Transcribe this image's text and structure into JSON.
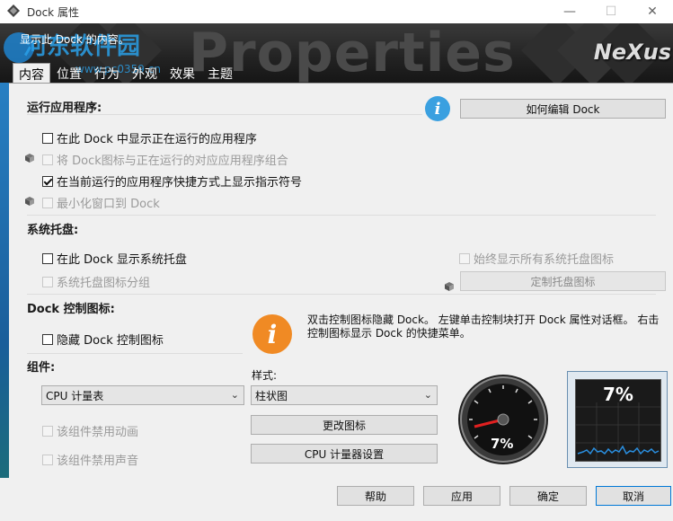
{
  "window": {
    "title": "Dock 属性",
    "controls": {
      "minimize": "—",
      "maximize": "☐",
      "close": "✕"
    }
  },
  "banner": {
    "subtitle": "显示此 Dock 的内容。",
    "title": "Properties",
    "brand": "NeXus",
    "watermark": "河东软件园",
    "watermark_url": "www.pc0359.cn"
  },
  "tabs": [
    "内容",
    "位置",
    "行为",
    "外观",
    "效果",
    "主题"
  ],
  "active_tab": 0,
  "running_apps": {
    "heading": "运行应用程序:",
    "edit_button": "如何编辑 Dock",
    "options": [
      {
        "label": "在此 Dock 中显示正在运行的应用程序",
        "checked": false,
        "enabled": true
      },
      {
        "label": "将 Dock图标与正在运行的对应应用程序组合",
        "checked": false,
        "enabled": false
      },
      {
        "label": "在当前运行的应用程序快捷方式上显示指示符号",
        "checked": true,
        "enabled": true
      },
      {
        "label": "最小化窗口到 Dock",
        "checked": false,
        "enabled": false
      }
    ]
  },
  "tray": {
    "heading": "系统托盘:",
    "show_tray": "在此 Dock 显示系统托盘",
    "group_icons": "系统托盘图标分组",
    "always_show": "始终显示所有系统托盘图标",
    "customize_button": "定制托盘图标"
  },
  "dock_icon": {
    "heading": "Dock 控制图标:",
    "hide_label": "隐藏 Dock 控制图标",
    "help": "双击控制图标隐藏 Dock。 左键单击控制块打开 Dock 属性对话框。 右击控制图标显示 Dock 的快捷菜单。"
  },
  "widgets": {
    "heading": "组件:",
    "widget_select": "CPU 计量表",
    "style_label": "样式:",
    "style_select": "柱状图",
    "change_icon_button": "更改图标",
    "cpu_settings_button": "CPU 计量器设置",
    "disable_animation": "该组件禁用动画",
    "disable_sound": "该组件禁用声音",
    "gauge_value": "7%",
    "meter_value": "7%"
  },
  "footer": {
    "help": "帮助",
    "apply": "应用",
    "ok": "确定",
    "cancel": "取消"
  },
  "colors": {
    "accent": "#0078d7",
    "info_blue": "#3aa0e0",
    "info_orange": "#f08a24",
    "gauge_needle": "#e02020"
  }
}
